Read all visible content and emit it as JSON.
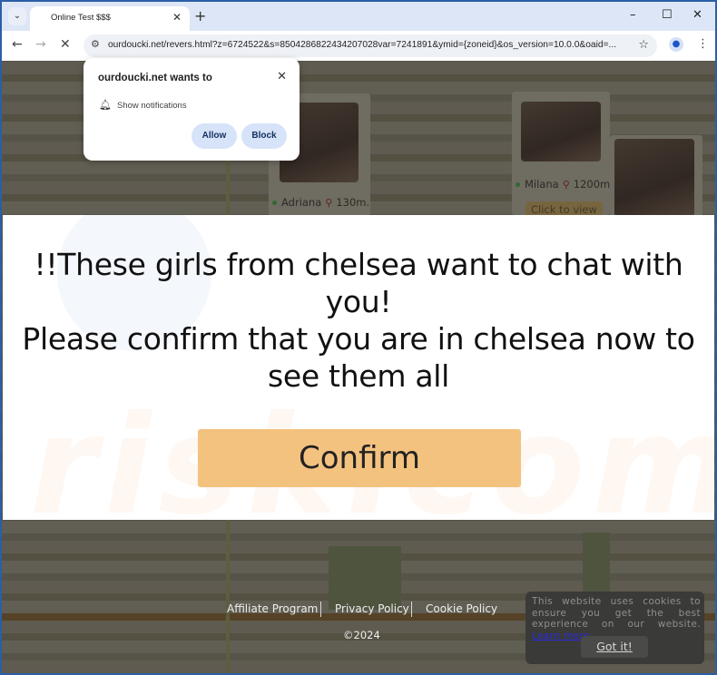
{
  "browser": {
    "tab": {
      "title": "Online Test $$$"
    },
    "new_tab_label": "+",
    "window_controls": {
      "minimize": "–",
      "maximize": "☐",
      "close": "✕"
    },
    "address_bar": {
      "url": "ourdoucki.net/revers.html?z=6724522&s=8504286822434207028var=7241891&ymid={zoneid}&os_version=10.0.0&oaid=..."
    }
  },
  "permission_prompt": {
    "title": "ourdoucki.net wants to",
    "permission": "Show notifications",
    "allow_label": "Allow",
    "block_label": "Block"
  },
  "background_cards": [
    {
      "name": "Adriana",
      "distance": "130m."
    },
    {
      "name": "Milana",
      "distance": "1200m",
      "cta": "Click to view"
    }
  ],
  "modal": {
    "line1": "!!These girls from chelsea want to chat with you!",
    "line2": "Please confirm that you are in chelsea now to see them all",
    "confirm_label": "Confirm"
  },
  "footer": {
    "links": [
      "Affiliate Program",
      "Privacy Policy",
      "Cookie Policy"
    ],
    "copyright": "©2024"
  },
  "cookie_banner": {
    "text": "This website uses cookies to ensure you get the best experience on our website.",
    "learn_more": "Learn more",
    "button_label": "Got it!"
  },
  "watermark": {
    "text": "risk.com"
  },
  "colors": {
    "confirm_button": "#f4c27f",
    "permission_button": "#d6e3f8",
    "tabstrip": "#dde6f6",
    "window_frame": "#2b5ea7"
  }
}
